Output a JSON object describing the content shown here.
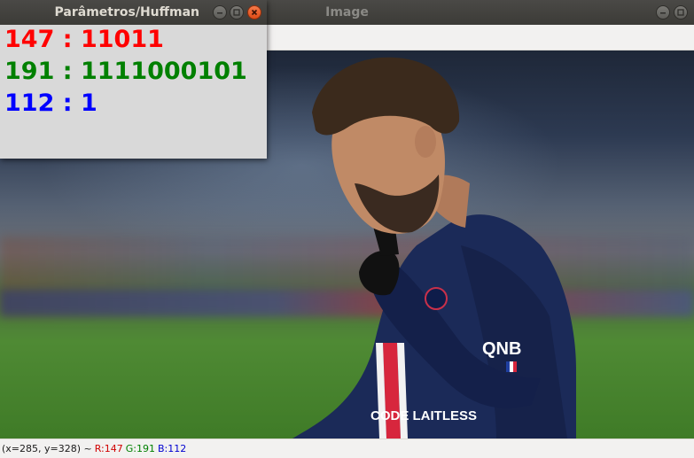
{
  "image_window": {
    "title": "Image",
    "status": {
      "coords": "(x=285, y=328) ~",
      "r": "R:147",
      "g": "G:191",
      "b": "B:112"
    }
  },
  "param_window": {
    "title": "Parâmetros/Huffman",
    "lines": [
      {
        "text": "147 : 11011",
        "color": "#ff0000"
      },
      {
        "text": "191 : 1111000101",
        "color": "#008000"
      },
      {
        "text": "112 : 1",
        "color": "#0000ff"
      }
    ]
  },
  "photo": {
    "jersey_sponsor": "QNB",
    "jersey_text": "CODE LAITLESS"
  },
  "colors": {
    "titlebar": "#3c3b37",
    "close_button": "#df4b16",
    "panel": "#d9d9d9"
  }
}
